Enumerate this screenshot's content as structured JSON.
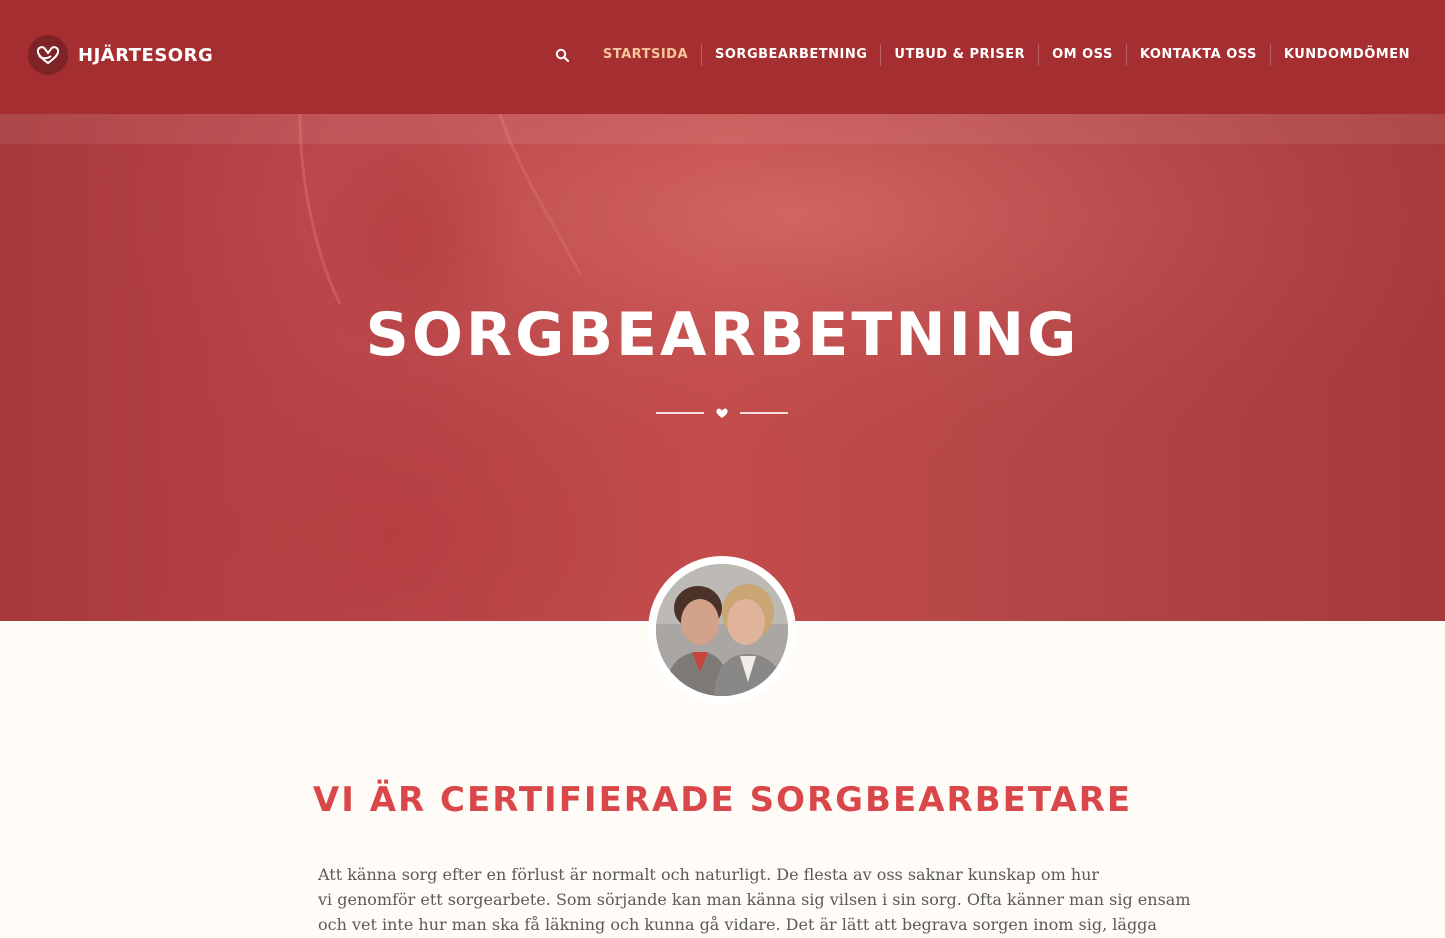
{
  "brand": {
    "name": "HJÄRTESORG",
    "logo_icon": "heart-hands-icon"
  },
  "nav": {
    "search_icon": "search-icon",
    "items": [
      {
        "label": "STARTSIDA",
        "active": true
      },
      {
        "label": "SORGBEARBETNING",
        "active": false
      },
      {
        "label": "UTBUD & PRISER",
        "active": false
      },
      {
        "label": "OM OSS",
        "active": false
      },
      {
        "label": "KONTAKTA OSS",
        "active": false
      },
      {
        "label": "KUNDOMDÖMEN",
        "active": false
      }
    ]
  },
  "hero": {
    "title": "SORGBEARBETNING",
    "divider_icon": "heart-icon"
  },
  "section": {
    "title": "VI ÄR CERTIFIERADE SORGBEARBETARE",
    "lines": [
      "Att känna sorg efter en förlust är normalt och naturligt. De flesta av oss saknar kunskap om hur",
      "vi genomför ett sorgearbete. Som sörjande kan man känna sig vilsen i sin sorg. Ofta känner man sig ensam",
      "och vet inte hur man ska få läkning och kunna gå vidare. Det är lätt att begrava sorgen inom sig, lägga"
    ]
  },
  "colors": {
    "header": "#a52e31",
    "nav_active": "#f5c79b",
    "heading_accent": "#d9474a",
    "page_background": "#fffbf6"
  }
}
